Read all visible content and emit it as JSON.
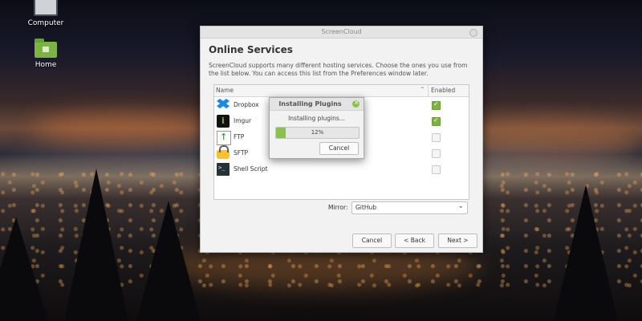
{
  "desktop": {
    "icons": [
      {
        "label": "Computer"
      },
      {
        "label": "Home"
      }
    ]
  },
  "window": {
    "title": "ScreenCloud",
    "heading": "Online Services",
    "description": "ScreenCloud supports many different hosting services. Choose the ones you use from the list below. You can access this list from the Preferences window later.",
    "columns": {
      "name": "Name",
      "enabled": "Enabled"
    },
    "services": [
      {
        "name": "Dropbox",
        "icon": "dropbox-icon",
        "enabled": true
      },
      {
        "name": "Imgur",
        "icon": "imgur-icon",
        "enabled": true
      },
      {
        "name": "FTP",
        "icon": "ftp-icon",
        "enabled": false
      },
      {
        "name": "SFTP",
        "icon": "sftp-icon",
        "enabled": false
      },
      {
        "name": "Shell Script",
        "icon": "shell-script-icon",
        "enabled": false
      }
    ],
    "mirror_label": "Mirror:",
    "mirror_value": "GitHub",
    "buttons": {
      "cancel": "Cancel",
      "back": "< Back",
      "next": "Next >"
    }
  },
  "dialog": {
    "title": "Installing Plugins",
    "message": "Installing plugins...",
    "progress": 12,
    "progress_text": "12%",
    "cancel": "Cancel"
  },
  "colors": {
    "accent": "#8bc34a",
    "checkbox_on": "#7cb342"
  }
}
